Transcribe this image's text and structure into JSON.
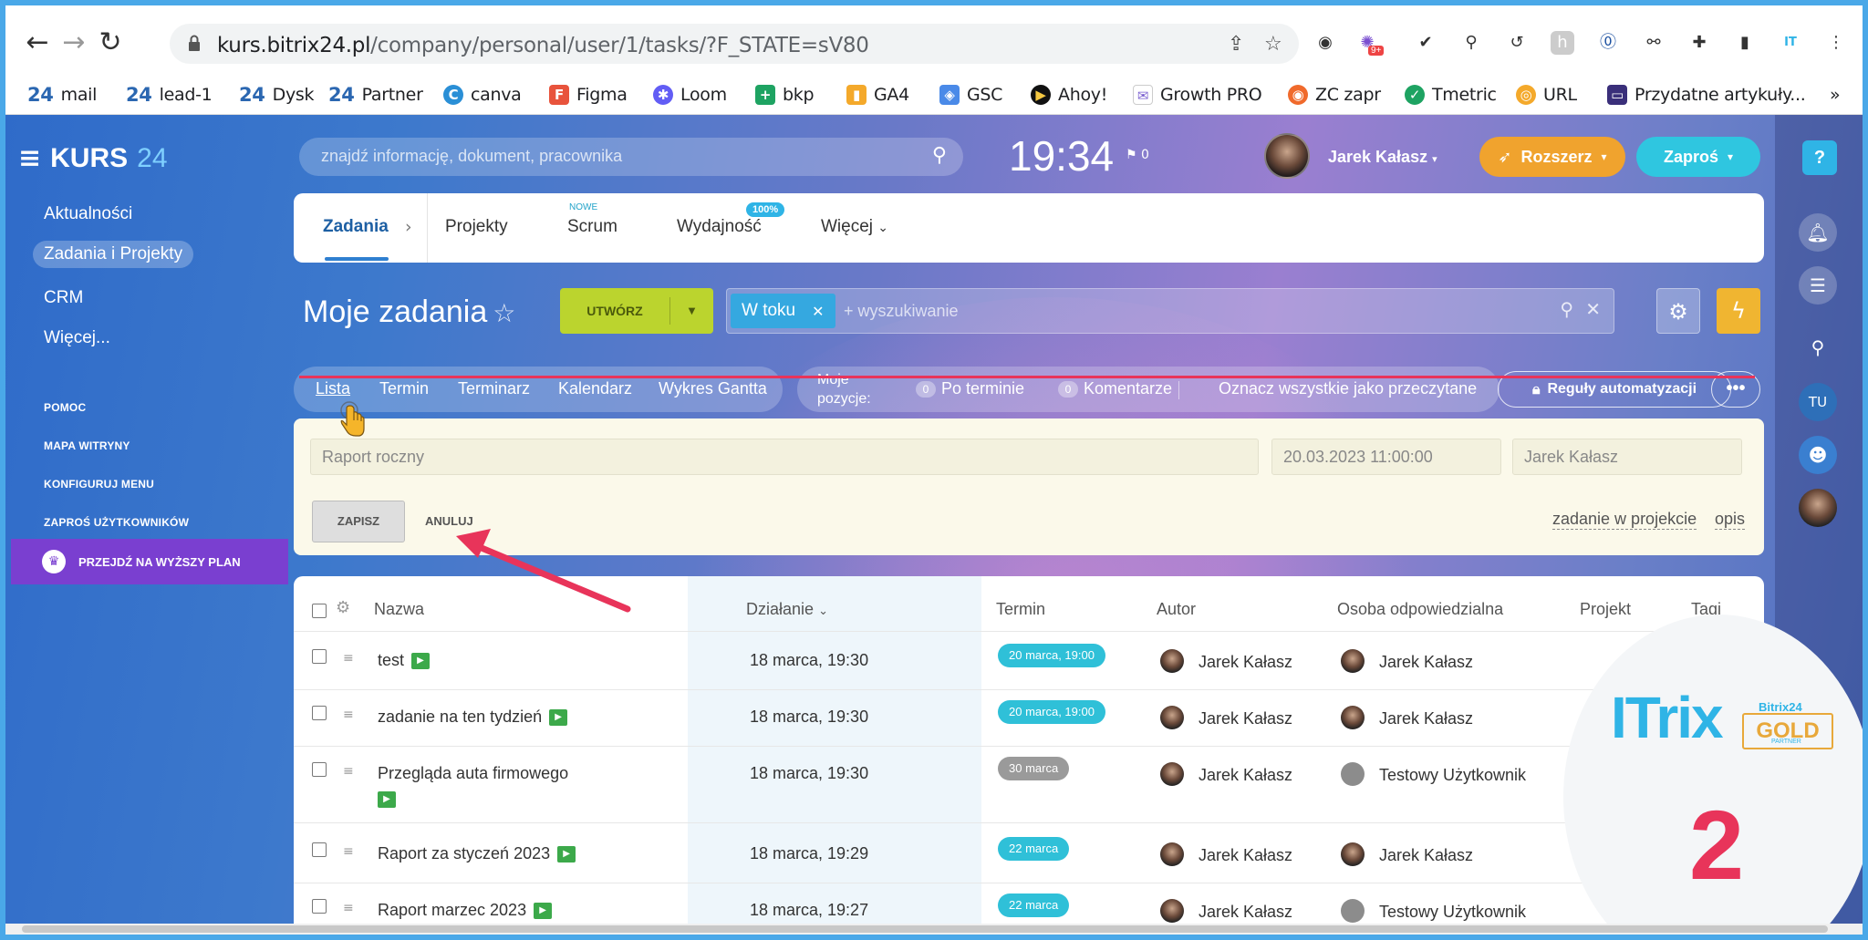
{
  "browser": {
    "url_domain": "kurs.bitrix24.pl",
    "url_path": "/company/personal/user/1/tasks/?F_STATE=sV80",
    "ext_badge": "9+",
    "bookmarks": [
      {
        "label": "mail",
        "icon": "24"
      },
      {
        "label": "lead-1",
        "icon": "24"
      },
      {
        "label": "Dysk",
        "icon": "24"
      },
      {
        "label": "Partner",
        "icon": "24"
      },
      {
        "label": "canva",
        "icon": "C"
      },
      {
        "label": "Figma",
        "icon": "F"
      },
      {
        "label": "Loom",
        "icon": "✱"
      },
      {
        "label": "bkp",
        "icon": "+"
      },
      {
        "label": "GA4",
        "icon": "▮"
      },
      {
        "label": "GSC",
        "icon": "◈"
      },
      {
        "label": "Ahoy!",
        "icon": "▶"
      },
      {
        "label": "Growth PRO",
        "icon": "✉"
      },
      {
        "label": "ZC zapr",
        "icon": "◉"
      },
      {
        "label": "Tmetric",
        "icon": "✓"
      },
      {
        "label": "URL",
        "icon": "◎"
      },
      {
        "label": "Przydatne artykuły...",
        "icon": "▭"
      }
    ],
    "overflow": "»"
  },
  "app": {
    "logo_text": "KURS",
    "logo_num": "24",
    "search_placeholder": "znajdź informację, dokument, pracownika",
    "clock": "19:34",
    "flag_count": "0",
    "user_name": "Jarek Kałasz",
    "upgrade_label": "Rozszerz",
    "invite_label": "Zaproś"
  },
  "sidebar": {
    "items": [
      "Aktualności",
      "Zadania i Projekty",
      "CRM",
      "Więcej..."
    ],
    "small_links": [
      "POMOC",
      "MAPA WITRYNY",
      "KONFIGURUJ MENU",
      "ZAPROŚ UŻYTKOWNIKÓW"
    ],
    "upgrade_plan": "PRZEJDŹ NA WYŻSZY PLAN"
  },
  "tabs": {
    "items": [
      "Zadania",
      "Projekty",
      "Scrum",
      "Wydajność",
      "Więcej"
    ],
    "new_badge": "NOWE",
    "percent_badge": "100%"
  },
  "toolbar": {
    "title": "Moje zadania",
    "create_label": "UTWÓRZ",
    "filter_chip": "W toku",
    "filter_placeholder": "+ wyszukiwanie"
  },
  "views": {
    "items": [
      "Lista",
      "Termin",
      "Terminarz",
      "Kalendarz",
      "Wykres Gantta"
    ],
    "counters_label": "Moje pozycje:",
    "overdue_count": "0",
    "overdue_label": "Po terminie",
    "comments_count": "0",
    "comments_label": "Komentarze",
    "mark_read": "Oznacz wszystkie jako przeczytane",
    "rules_label": "Reguły automatyzacji",
    "more_label": "•••"
  },
  "quick_add": {
    "task_name": "Raport roczny",
    "deadline": "20.03.2023 11:00:00",
    "responsible": "Jarek Kałasz",
    "save_label": "ZAPISZ",
    "cancel_label": "ANULUJ",
    "project_link": "zadanie w projekcie",
    "description_link": "opis"
  },
  "table": {
    "headers": [
      "Nazwa",
      "Działanie",
      "Termin",
      "Autor",
      "Osoba odpowiedzialna",
      "Projekt",
      "Tagi"
    ],
    "rows": [
      {
        "name": "test",
        "activity": "18 marca, 19:30",
        "deadline": "20 marca, 19:00",
        "deadline_style": "teal",
        "author": "Jarek Kałasz",
        "responsible": "Jarek Kałasz"
      },
      {
        "name": "zadanie na ten tydzień",
        "activity": "18 marca, 19:30",
        "deadline": "20 marca, 19:00",
        "deadline_style": "teal",
        "author": "Jarek Kałasz",
        "responsible": "Jarek Kałasz"
      },
      {
        "name": "Przegląda auta firmowego",
        "activity": "18 marca, 19:30",
        "deadline": "30 marca",
        "deadline_style": "gray",
        "author": "Jarek Kałasz",
        "responsible": "Testowy Użytkownik"
      },
      {
        "name": "Raport za styczeń 2023",
        "activity": "18 marca, 19:29",
        "deadline": "22 marca",
        "deadline_style": "teal",
        "author": "Jarek Kałasz",
        "responsible": "Jarek Kałasz"
      },
      {
        "name": "Raport marzec 2023",
        "activity": "18 marca, 19:27",
        "deadline": "22 marca",
        "deadline_style": "teal",
        "author": "Jarek Kałasz",
        "responsible": "Testowy Użytkownik"
      }
    ]
  },
  "right_panel": {
    "help": "?",
    "user_initials": "TU"
  },
  "partner_badge": {
    "brand": "ITrix",
    "program": "Bitrix24",
    "level": "GOLD",
    "tier": "PARTNER",
    "number": "2"
  },
  "colors": {
    "accent_red": "#e8345a",
    "create_green": "#bbd42e",
    "chip_blue": "#35a8e0",
    "upgrade_purple": "#7a3fd0"
  }
}
